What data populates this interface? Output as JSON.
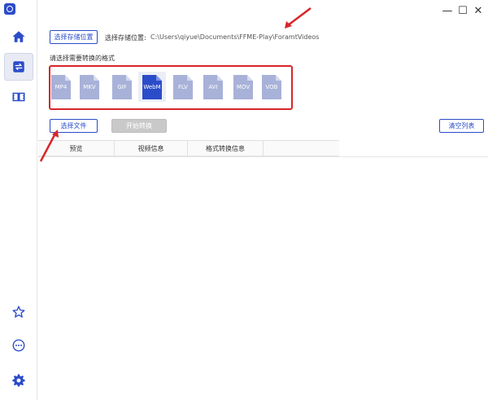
{
  "window": {
    "minimize": "—",
    "maximize": "☐",
    "close": "✕"
  },
  "storage": {
    "button_label": "选择存储位置",
    "label": "选择存储位置:",
    "path": "C:\\Users\\qiyue\\Documents\\FFME-Play\\ForamtVideos"
  },
  "formats": {
    "prompt": "请选择需要转换的格式",
    "items": [
      {
        "label": "MP4"
      },
      {
        "label": "MKV"
      },
      {
        "label": "GIF"
      },
      {
        "label": "WebM"
      },
      {
        "label": "FLV"
      },
      {
        "label": "AVI"
      },
      {
        "label": "MOV"
      },
      {
        "label": "VOB"
      }
    ],
    "selected": "WebM"
  },
  "actions": {
    "select_file": "选择文件",
    "start_convert": "开始转换",
    "clear_list": "清空列表"
  },
  "table": {
    "columns": [
      "预览",
      "视频信息",
      "格式转换信息"
    ]
  },
  "colors": {
    "accent": "#2b4cc9",
    "highlight_red": "#d8262a",
    "format_icon": "#a8b1d8"
  },
  "sidebar": {
    "items": [
      {
        "icon": "home-icon"
      },
      {
        "icon": "convert-icon",
        "active": true
      },
      {
        "icon": "video-edit-icon"
      },
      {
        "icon": "star-icon"
      },
      {
        "icon": "more-icon"
      },
      {
        "icon": "settings-icon"
      }
    ]
  }
}
